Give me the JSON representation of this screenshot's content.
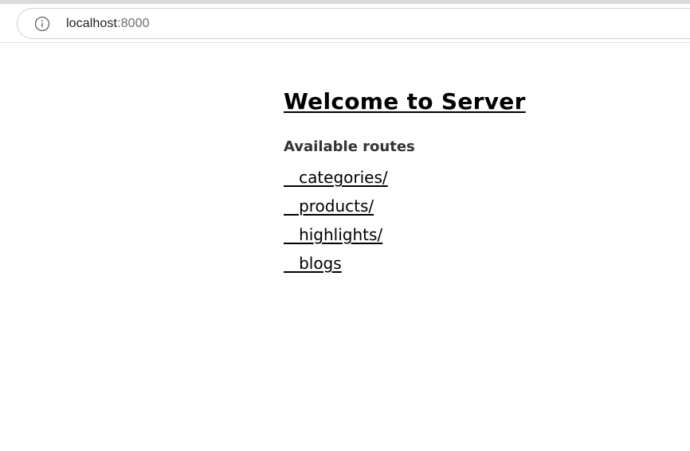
{
  "browser": {
    "url_host": "localhost",
    "url_port": ":8000",
    "info_icon": "info-icon"
  },
  "page": {
    "title": "Welcome to Server",
    "routes_heading": "Available routes",
    "routes": [
      {
        "label": "   categories/"
      },
      {
        "label": "   products/"
      },
      {
        "label": "   highlights/"
      },
      {
        "label": "   blogs"
      }
    ]
  }
}
